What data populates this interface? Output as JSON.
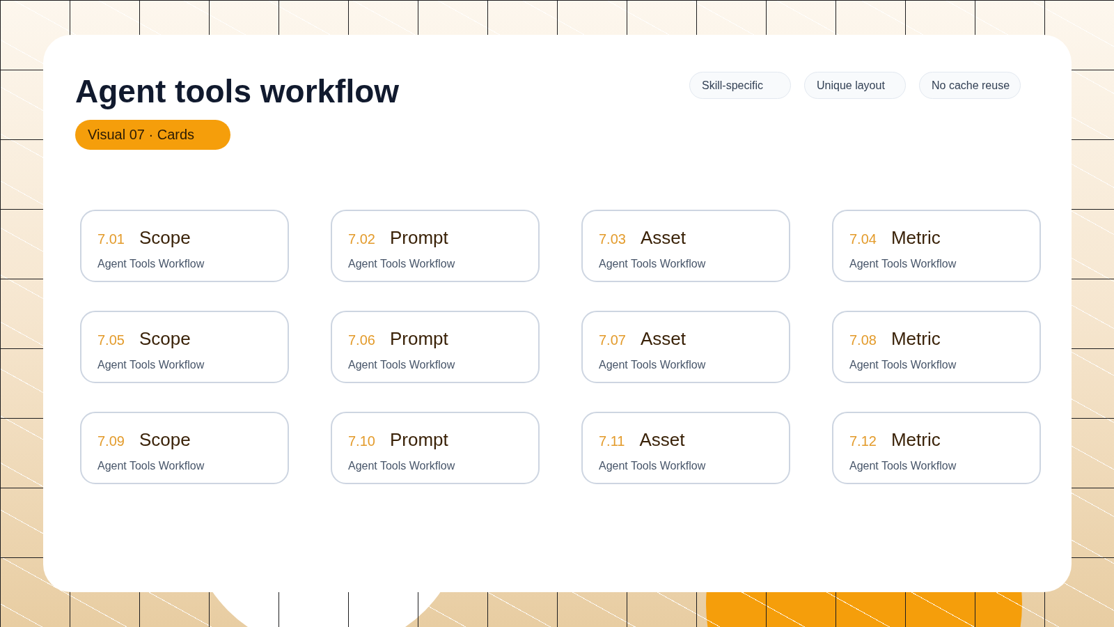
{
  "title": "Agent tools workflow",
  "badge": "Visual 07 · Cards",
  "tags": [
    "Skill-specific",
    "Unique layout",
    "No cache reuse"
  ],
  "cards": [
    {
      "number": "7.01",
      "title": "Scope",
      "subtitle": "Agent Tools Workflow"
    },
    {
      "number": "7.02",
      "title": "Prompt",
      "subtitle": "Agent Tools Workflow"
    },
    {
      "number": "7.03",
      "title": "Asset",
      "subtitle": "Agent Tools Workflow"
    },
    {
      "number": "7.04",
      "title": "Metric",
      "subtitle": "Agent Tools Workflow"
    },
    {
      "number": "7.05",
      "title": "Scope",
      "subtitle": "Agent Tools Workflow"
    },
    {
      "number": "7.06",
      "title": "Prompt",
      "subtitle": "Agent Tools Workflow"
    },
    {
      "number": "7.07",
      "title": "Asset",
      "subtitle": "Agent Tools Workflow"
    },
    {
      "number": "7.08",
      "title": "Metric",
      "subtitle": "Agent Tools Workflow"
    },
    {
      "number": "7.09",
      "title": "Scope",
      "subtitle": "Agent Tools Workflow"
    },
    {
      "number": "7.10",
      "title": "Prompt",
      "subtitle": "Agent Tools Workflow"
    },
    {
      "number": "7.11",
      "title": "Asset",
      "subtitle": "Agent Tools Workflow"
    },
    {
      "number": "7.12",
      "title": "Metric",
      "subtitle": "Agent Tools Workflow"
    }
  ]
}
